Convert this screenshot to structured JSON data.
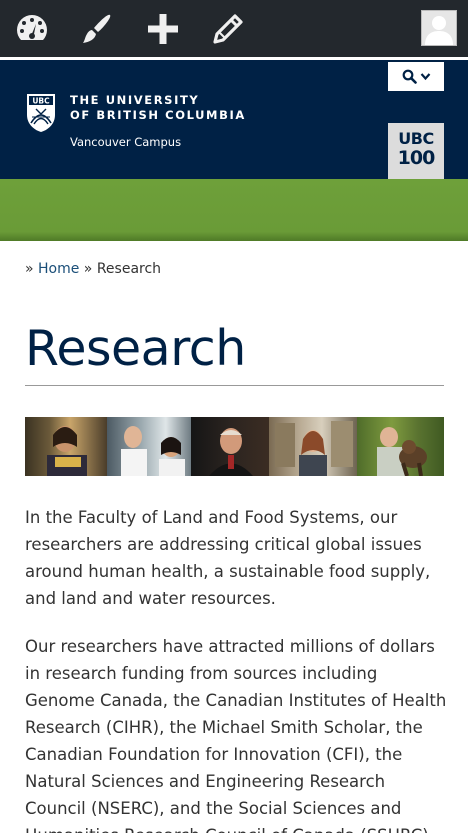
{
  "adminbar": {
    "icons": [
      "dashboard-icon",
      "customize-brush-icon",
      "new-content-plus-icon",
      "edit-pencil-icon"
    ],
    "avatar": "user-avatar-icon"
  },
  "header": {
    "crest_text": "UBC",
    "university_line1": "THE UNIVERSITY",
    "university_line2": "OF BRITISH COLUMBIA",
    "campus": "Vancouver Campus",
    "search_icon": "search-icon",
    "ubc100_line1": "UBC",
    "ubc100_line2": "100"
  },
  "breadcrumb": {
    "sep1": "» ",
    "home": "Home",
    "sep2": " » ",
    "current": "Research"
  },
  "page": {
    "title": "Research",
    "paragraphs": [
      "In the Faculty of Land and Food Systems, our researchers are addressing critical global issues around human health, a sustainable food supply, and land and water resources.",
      "Our researchers have attracted millions of dollars in research funding from sources including Genome Canada, the Canadian Institutes of Health Research (CIHR), the Michael Smith Scholar, the Canadian Foundation for Innovation (CFI), the Natural Sciences and Engineering Research Council (NSERC), and the Social Sciences and Humanities Research Council of Canada (SSHRC)."
    ]
  },
  "colors": {
    "adminbar": "#23282d",
    "ubc_blue": "#002145",
    "green": "#6ea03a"
  }
}
